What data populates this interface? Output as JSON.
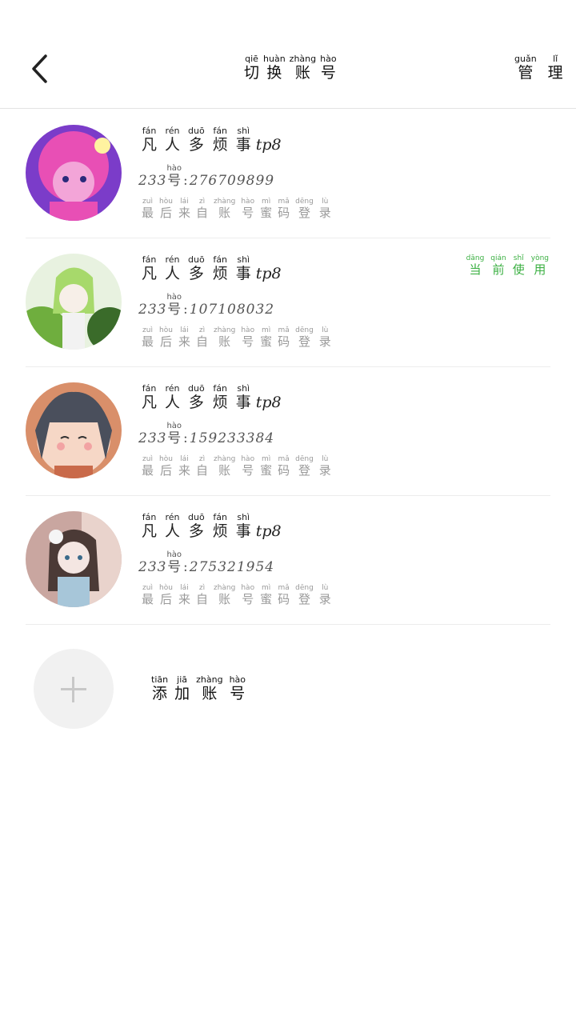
{
  "header": {
    "back_icon": "chevron-left-icon",
    "title": [
      {
        "py": "qiē",
        "hz": "切"
      },
      {
        "py": "huàn",
        "hz": "换"
      },
      {
        "py": "zhàng",
        "hz": "账"
      },
      {
        "py": "hào",
        "hz": "号"
      }
    ],
    "manage": [
      {
        "py": "guǎn",
        "hz": "管"
      },
      {
        "py": "lǐ",
        "hz": "理"
      }
    ]
  },
  "accounts": [
    {
      "name": [
        {
          "py": "fán",
          "hz": "凡"
        },
        {
          "py": "rén",
          "hz": "人"
        },
        {
          "py": "duō",
          "hz": "多"
        },
        {
          "py": "fán",
          "hz": "烦"
        },
        {
          "py": "shì",
          "hz": "事"
        }
      ],
      "name_suffix": "tp8",
      "uid_prefix": "233",
      "uid_char": {
        "py": "hào",
        "hz": "号"
      },
      "uid_colon": ":",
      "uid": "276709899",
      "hint": [
        {
          "py": "zuì",
          "hz": "最"
        },
        {
          "py": "hòu",
          "hz": "后"
        },
        {
          "py": "lái",
          "hz": "来"
        },
        {
          "py": "zì",
          "hz": "自"
        },
        {
          "py": "zhàng",
          "hz": "账"
        },
        {
          "py": "hào",
          "hz": "号"
        },
        {
          "py": "mì",
          "hz": "蜜"
        },
        {
          "py": "mǎ",
          "hz": "码"
        },
        {
          "py": "dēng",
          "hz": "登"
        },
        {
          "py": "lù",
          "hz": "录"
        }
      ],
      "current": false,
      "avatar_colors": [
        "#e84fb5",
        "#7b3cc9",
        "#f3a5d8",
        "#2a2a7a"
      ]
    },
    {
      "name": [
        {
          "py": "fán",
          "hz": "凡"
        },
        {
          "py": "rén",
          "hz": "人"
        },
        {
          "py": "duō",
          "hz": "多"
        },
        {
          "py": "fán",
          "hz": "烦"
        },
        {
          "py": "shì",
          "hz": "事"
        }
      ],
      "name_suffix": "tp8",
      "uid_prefix": "233",
      "uid_char": {
        "py": "hào",
        "hz": "号"
      },
      "uid_colon": ":",
      "uid": "107108032",
      "hint": [
        {
          "py": "zuì",
          "hz": "最"
        },
        {
          "py": "hòu",
          "hz": "后"
        },
        {
          "py": "lái",
          "hz": "来"
        },
        {
          "py": "zì",
          "hz": "自"
        },
        {
          "py": "zhàng",
          "hz": "账"
        },
        {
          "py": "hào",
          "hz": "号"
        },
        {
          "py": "mì",
          "hz": "蜜"
        },
        {
          "py": "mǎ",
          "hz": "码"
        },
        {
          "py": "dēng",
          "hz": "登"
        },
        {
          "py": "lù",
          "hz": "录"
        }
      ],
      "current": true,
      "current_label": [
        {
          "py": "dāng",
          "hz": "当"
        },
        {
          "py": "qián",
          "hz": "前"
        },
        {
          "py": "shǐ",
          "hz": "使"
        },
        {
          "py": "yòng",
          "hz": "用"
        }
      ],
      "avatar_colors": [
        "#6fae3e",
        "#a7d96b",
        "#e8f2e0",
        "#3a6b2a"
      ]
    },
    {
      "name": [
        {
          "py": "fán",
          "hz": "凡"
        },
        {
          "py": "rén",
          "hz": "人"
        },
        {
          "py": "duō",
          "hz": "多"
        },
        {
          "py": "fán",
          "hz": "烦"
        },
        {
          "py": "shì",
          "hz": "事"
        }
      ],
      "name_suffix": "tp8",
      "uid_prefix": "233",
      "uid_char": {
        "py": "hào",
        "hz": "号"
      },
      "uid_colon": ":",
      "uid": "159233384",
      "hint": [
        {
          "py": "zuì",
          "hz": "最"
        },
        {
          "py": "hòu",
          "hz": "后"
        },
        {
          "py": "lái",
          "hz": "来"
        },
        {
          "py": "zì",
          "hz": "自"
        },
        {
          "py": "zhàng",
          "hz": "账"
        },
        {
          "py": "hào",
          "hz": "号"
        },
        {
          "py": "mì",
          "hz": "蜜"
        },
        {
          "py": "mǎ",
          "hz": "码"
        },
        {
          "py": "dēng",
          "hz": "登"
        },
        {
          "py": "lù",
          "hz": "录"
        }
      ],
      "current": false,
      "avatar_colors": [
        "#d98f6a",
        "#4a4f5c",
        "#f6d7c6",
        "#c96a4a"
      ]
    },
    {
      "name": [
        {
          "py": "fán",
          "hz": "凡"
        },
        {
          "py": "rén",
          "hz": "人"
        },
        {
          "py": "duō",
          "hz": "多"
        },
        {
          "py": "fán",
          "hz": "烦"
        },
        {
          "py": "shì",
          "hz": "事"
        }
      ],
      "name_suffix": "tp8",
      "uid_prefix": "233",
      "uid_char": {
        "py": "hào",
        "hz": "号"
      },
      "uid_colon": ":",
      "uid": "275321954",
      "hint": [
        {
          "py": "zuì",
          "hz": "最"
        },
        {
          "py": "hòu",
          "hz": "后"
        },
        {
          "py": "lái",
          "hz": "来"
        },
        {
          "py": "zì",
          "hz": "自"
        },
        {
          "py": "zhàng",
          "hz": "账"
        },
        {
          "py": "hào",
          "hz": "号"
        },
        {
          "py": "mì",
          "hz": "蜜"
        },
        {
          "py": "mǎ",
          "hz": "码"
        },
        {
          "py": "dēng",
          "hz": "登"
        },
        {
          "py": "lù",
          "hz": "录"
        }
      ],
      "current": false,
      "avatar_colors": [
        "#c9a6a0",
        "#4b3a36",
        "#f4e6e2",
        "#a7c6d9"
      ]
    }
  ],
  "add_account": {
    "icon": "plus-icon",
    "label": [
      {
        "py": "tiān",
        "hz": "添"
      },
      {
        "py": "jiā",
        "hz": "加"
      },
      {
        "py": "zhàng",
        "hz": "账"
      },
      {
        "py": "hào",
        "hz": "号"
      }
    ]
  },
  "colors": {
    "current_badge": "#3cb043",
    "divider": "#ececec",
    "add_circle_bg": "#f1f1f1"
  }
}
